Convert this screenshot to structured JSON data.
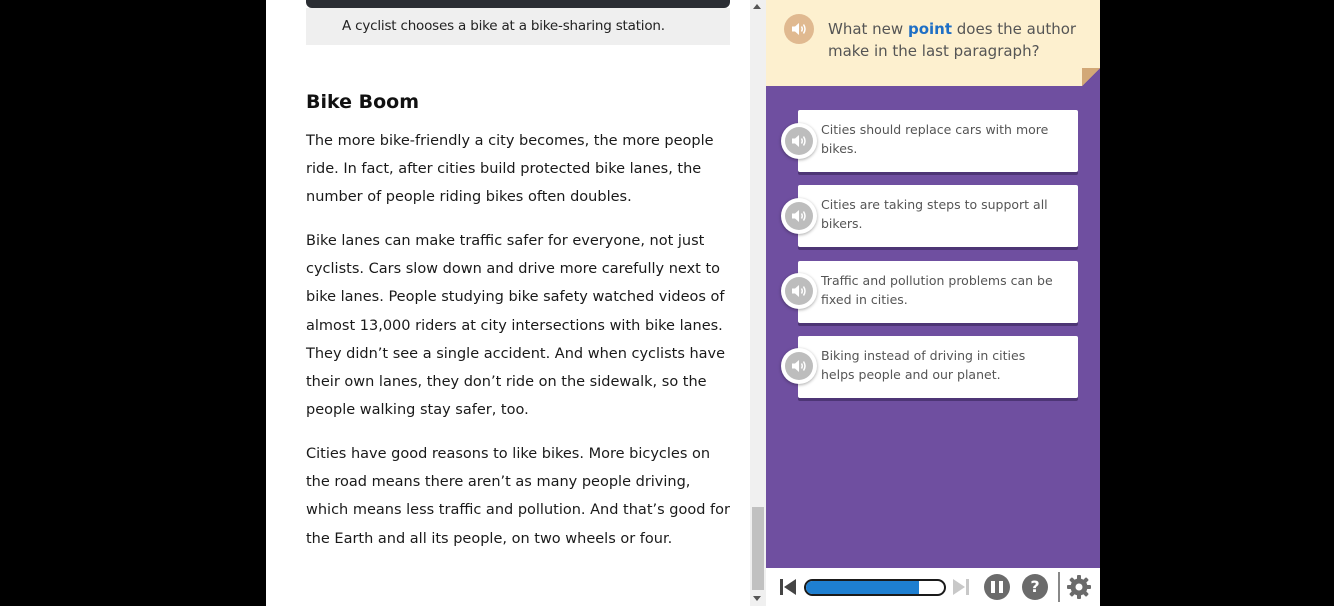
{
  "article": {
    "caption": "A cyclist chooses a bike at a bike-sharing station.",
    "heading": "Bike Boom",
    "paragraphs": [
      "The more bike-friendly a city becomes, the more people ride. In fact, after cities build protected bike lanes, the number of people riding bikes often doubles.",
      "Bike lanes can make traffic safer for everyone, not just cyclists. Cars slow down and drive more carefully next to bike lanes. People studying bike safety watched videos of almost 13,000 riders at city intersections with bike lanes. They didn’t see a single accident. And when cyclists have their own lanes, they don’t ride on the sidewalk, so the people walking stay safer, too.",
      "Cities have good reasons to like bikes. More bicycles on the road means there aren’t as many people driving, which means less traffic and pollution. And that’s good for the Earth and all its people, on two wheels or four."
    ]
  },
  "question": {
    "prefix": "What new ",
    "keyword": "point",
    "suffix": " does the author make in the last paragraph?",
    "options": [
      "Cities should replace cars with more bikes.",
      "Cities are taking steps to support all bikers.",
      "Traffic and pollution problems can be fixed in cities.",
      "Biking instead of driving in cities helps people and our planet."
    ]
  },
  "toolbar": {
    "progress_fraction": 0.82,
    "help_label": "?"
  },
  "icons": {
    "audio": "speaker-icon",
    "prev": "skip-back-icon",
    "next": "skip-forward-icon",
    "pause": "pause-icon",
    "help": "help-icon",
    "settings": "gear-icon"
  },
  "colors": {
    "panel_bg": "#6f4fa0",
    "question_bg": "#fdf0cf",
    "keyword": "#1f6fc5",
    "progress": "#1e7fd1"
  }
}
